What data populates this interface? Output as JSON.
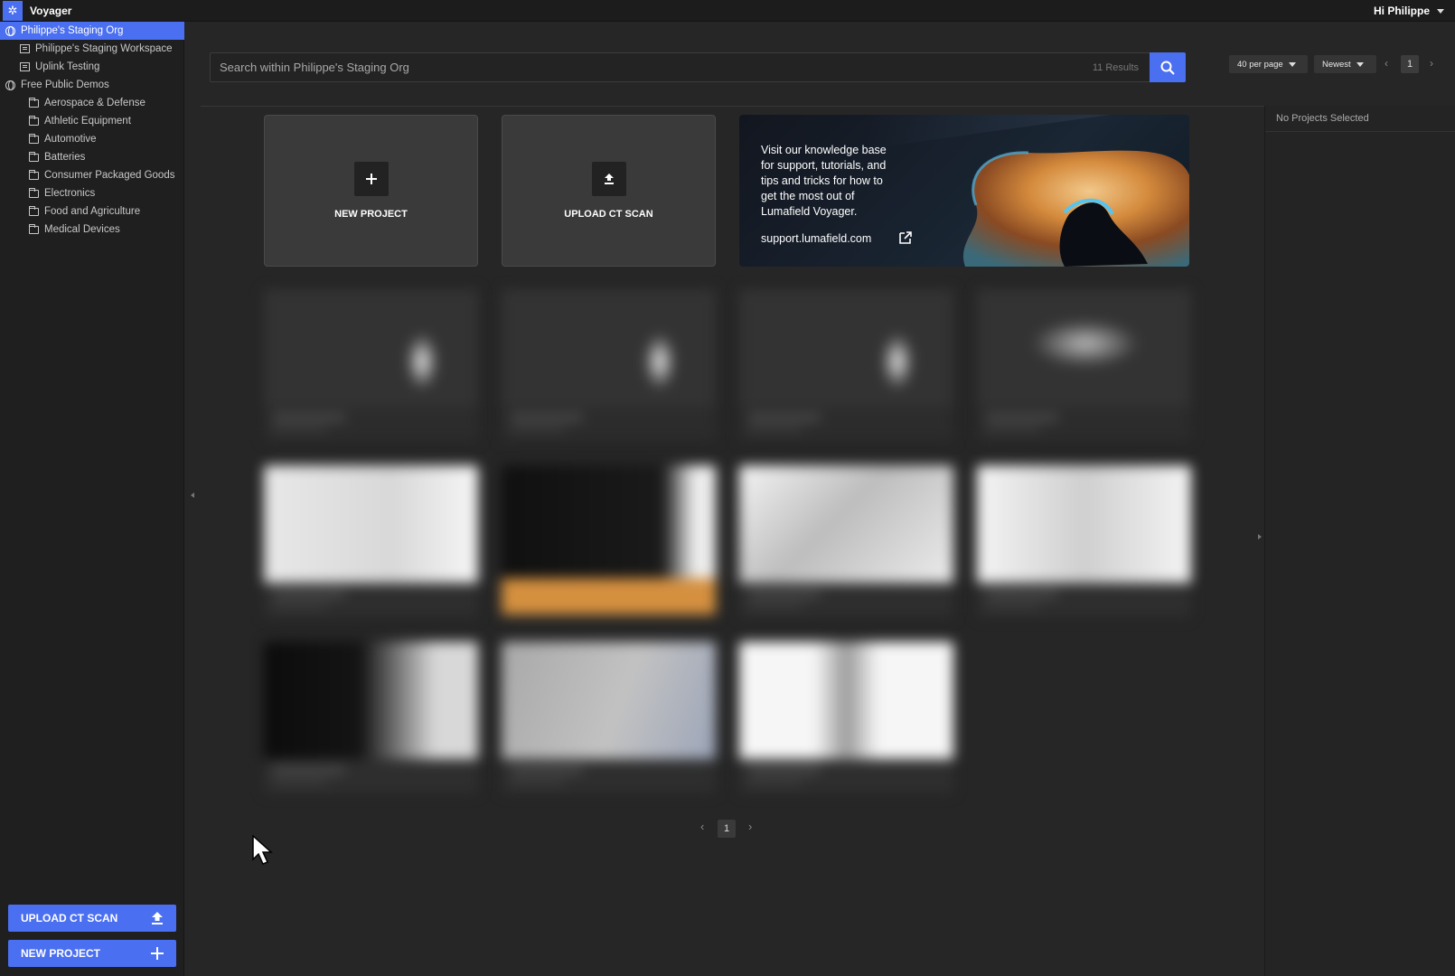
{
  "app": {
    "title": "Voyager",
    "greeting": "Hi Philippe"
  },
  "sidebar": {
    "items": [
      {
        "label": "Philippe's Staging Org",
        "type": "org",
        "active": true
      },
      {
        "label": "Philippe's Staging Workspace",
        "type": "workspace"
      },
      {
        "label": "Uplink Testing",
        "type": "workspace"
      },
      {
        "label": "Free Public Demos",
        "type": "org"
      },
      {
        "label": "Aerospace & Defense",
        "type": "folder"
      },
      {
        "label": "Athletic Equipment",
        "type": "folder"
      },
      {
        "label": "Automotive",
        "type": "folder"
      },
      {
        "label": "Batteries",
        "type": "folder"
      },
      {
        "label": "Consumer Packaged Goods",
        "type": "folder"
      },
      {
        "label": "Electronics",
        "type": "folder"
      },
      {
        "label": "Food and Agriculture",
        "type": "folder"
      },
      {
        "label": "Medical Devices",
        "type": "folder"
      }
    ],
    "upload_button": "UPLOAD CT SCAN",
    "new_project_button": "NEW PROJECT"
  },
  "search": {
    "placeholder": "Search within Philippe's Staging Org",
    "results": "11 Results"
  },
  "controls": {
    "per_page": "40 per page",
    "sort": "Newest",
    "page": "1"
  },
  "actions": {
    "new_project": "NEW PROJECT",
    "upload": "UPLOAD CT SCAN"
  },
  "promo": {
    "text": "Visit our knowledge base for support, tutorials, and tips and tricks for how to get the most out of Lumafield Voyager.",
    "link": "support.lumafield.com"
  },
  "right_panel": {
    "title": "No Projects Selected"
  },
  "bottom_pagination": {
    "page": "1"
  },
  "colors": {
    "accent": "#4a6ff0",
    "background": "#262626",
    "sidebar": "#1f1f1f"
  }
}
